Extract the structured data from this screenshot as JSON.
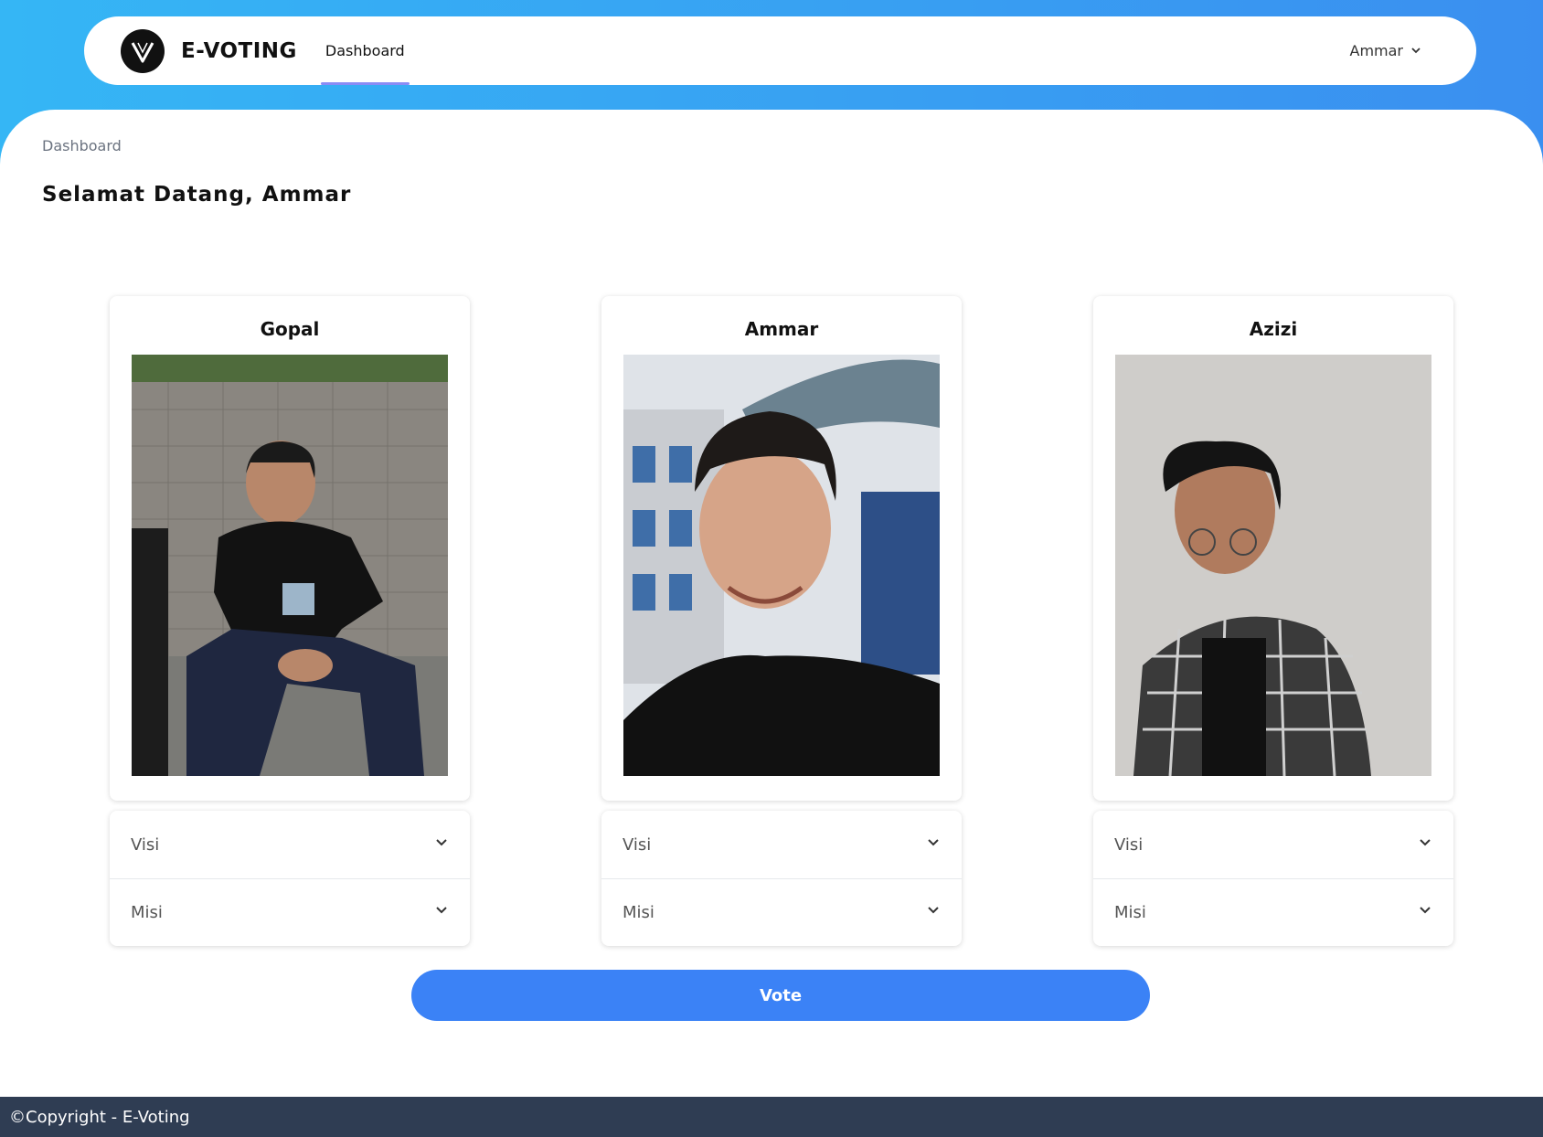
{
  "nav": {
    "brand": "E-VOTING",
    "logo_icon": "v-logo-icon",
    "links": [
      {
        "label": "Dashboard"
      }
    ],
    "user": {
      "name": "Ammar"
    }
  },
  "breadcrumb": "Dashboard",
  "page_title": "Selamat Datang, Ammar",
  "candidates": [
    {
      "name": "Gopal",
      "visi_label": "Visi",
      "misi_label": "Misi"
    },
    {
      "name": "Ammar",
      "visi_label": "Visi",
      "misi_label": "Misi"
    },
    {
      "name": "Azizi",
      "visi_label": "Visi",
      "misi_label": "Misi"
    }
  ],
  "vote_label": "Vote",
  "footer": "©Copyright - E-Voting",
  "colors": {
    "accent": "#3b82f6",
    "header_gradient_start": "#35b6f5",
    "header_gradient_end": "#3a8ff0",
    "footer_bg": "#2f3d53"
  }
}
